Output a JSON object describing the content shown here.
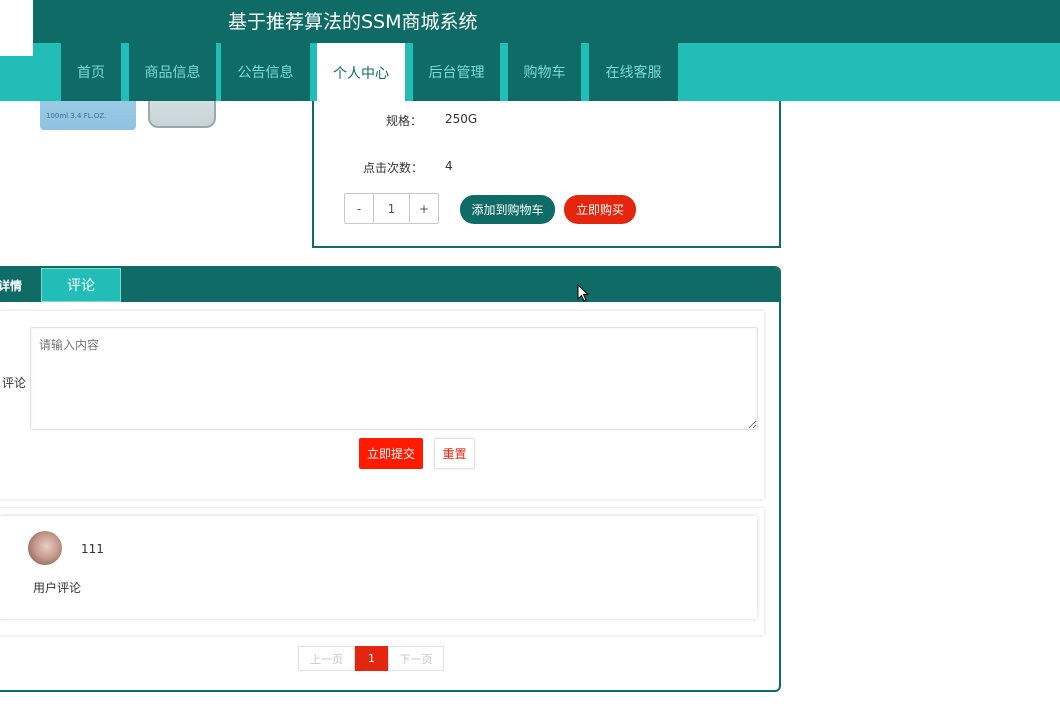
{
  "header": {
    "site_title": "基于推荐算法的SSM商城系统",
    "nav": [
      {
        "label": "首页",
        "active": false
      },
      {
        "label": "商品信息",
        "active": false
      },
      {
        "label": "公告信息",
        "active": false
      },
      {
        "label": "个人中心",
        "active": true
      },
      {
        "label": "后台管理",
        "active": false
      },
      {
        "label": "购物车",
        "active": false
      },
      {
        "label": "在线客服",
        "active": false
      }
    ]
  },
  "product": {
    "image_text": "100ml   3.4 FL.OZ.",
    "spec_label": "规格：",
    "spec_value": "250G",
    "clicks_label": "点击次数：",
    "clicks_value": "4",
    "qty_minus": "-",
    "qty_value": "1",
    "qty_plus": "+",
    "add_to_cart_label": "添加到购物车",
    "buy_now_label": "立即购买"
  },
  "tabs": {
    "detail_label": "详情",
    "comment_label": "评论"
  },
  "comment_form": {
    "label": "评论",
    "placeholder": "请输入内容",
    "submit_label": "立即提交",
    "reset_label": "重置"
  },
  "comments": [
    {
      "user": "111",
      "text": "用户评论"
    }
  ],
  "pagination": {
    "prev_label": "上一页",
    "current_page": "1",
    "next_label": "下一页"
  },
  "colors": {
    "primary": "#0f6b66",
    "accent": "#22bdb6",
    "danger": "#e5260f"
  }
}
